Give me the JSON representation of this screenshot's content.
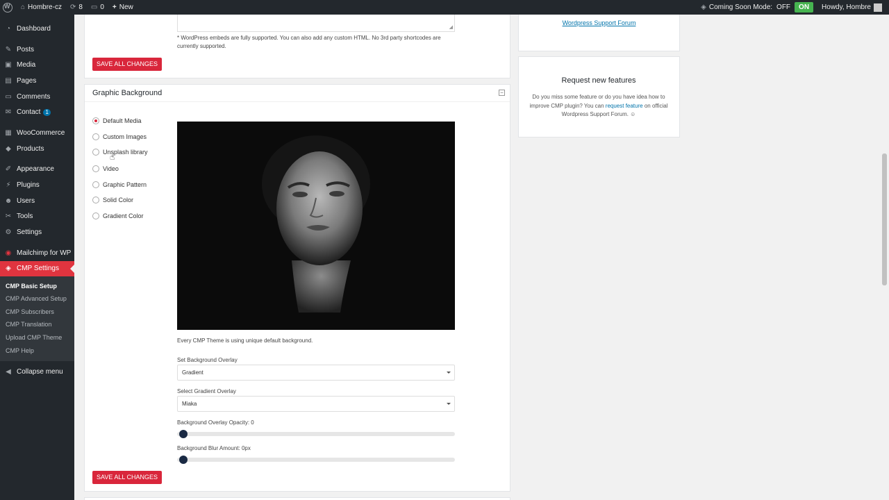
{
  "adminbar": {
    "site_name": "Hombre-cz",
    "updates_count": "8",
    "comments_count": "0",
    "new_label": "New",
    "coming_soon_label": "Coming Soon Mode:",
    "off_label": "OFF",
    "on_label": "ON",
    "greeting": "Howdy, Hombre"
  },
  "sidebar": {
    "items": [
      {
        "label": "Dashboard",
        "icon": "dashboard-icon"
      },
      {
        "label": "Posts",
        "icon": "pin-icon"
      },
      {
        "label": "Media",
        "icon": "media-icon"
      },
      {
        "label": "Pages",
        "icon": "page-icon"
      },
      {
        "label": "Comments",
        "icon": "comment-icon"
      },
      {
        "label": "Contact",
        "icon": "mail-icon",
        "badge": "1"
      },
      {
        "label": "WooCommerce",
        "icon": "woo-icon"
      },
      {
        "label": "Products",
        "icon": "products-icon"
      },
      {
        "label": "Appearance",
        "icon": "brush-icon"
      },
      {
        "label": "Plugins",
        "icon": "plugin-icon"
      },
      {
        "label": "Users",
        "icon": "users-icon"
      },
      {
        "label": "Tools",
        "icon": "wrench-icon"
      },
      {
        "label": "Settings",
        "icon": "settings-icon"
      },
      {
        "label": "Mailchimp for WP",
        "icon": "mailchimp-icon"
      },
      {
        "label": "CMP Settings",
        "icon": "cmp-icon"
      }
    ],
    "submenu": [
      "CMP Basic Setup",
      "CMP Advanced Setup",
      "CMP Subscribers",
      "CMP Translation",
      "Upload CMP Theme",
      "CMP Help"
    ],
    "collapse_label": "Collapse menu"
  },
  "top_section": {
    "note": "* WordPress embeds are fully supported. You can also add any custom HTML. No 3rd party shortcodes are currently supported.",
    "save_label": "SAVE ALL CHANGES"
  },
  "graphic_background": {
    "title": "Graphic Background",
    "options": [
      "Default Media",
      "Custom Images",
      "Unsplash library",
      "Video",
      "Graphic Pattern",
      "Solid Color",
      "Gradient Color"
    ],
    "selected": "Default Media",
    "caption": "Every CMP Theme is using unique default background.",
    "overlay_label": "Set Background Overlay",
    "overlay_value": "Gradient",
    "gradient_label": "Select Gradient Overlay",
    "gradient_value": "Miaka",
    "opacity_label": "Background Overlay Opacity: 0",
    "opacity_value": 0,
    "blur_label": "Background Blur Amount: 0px",
    "blur_value": 0,
    "save_label": "SAVE ALL CHANGES"
  },
  "right_panels": {
    "support_link": "Wordpress Support Forum",
    "features_title": "Request new features",
    "features_text_1": "Do you miss some feature or do you have idea how to improve CMP plugin? You can",
    "features_link": "request feature",
    "features_text_2": "on official Wordpress Support Forum. ☺"
  },
  "colors": {
    "accent": "#d9263b",
    "admin_bar": "#23282d",
    "on_green": "#46b450"
  }
}
